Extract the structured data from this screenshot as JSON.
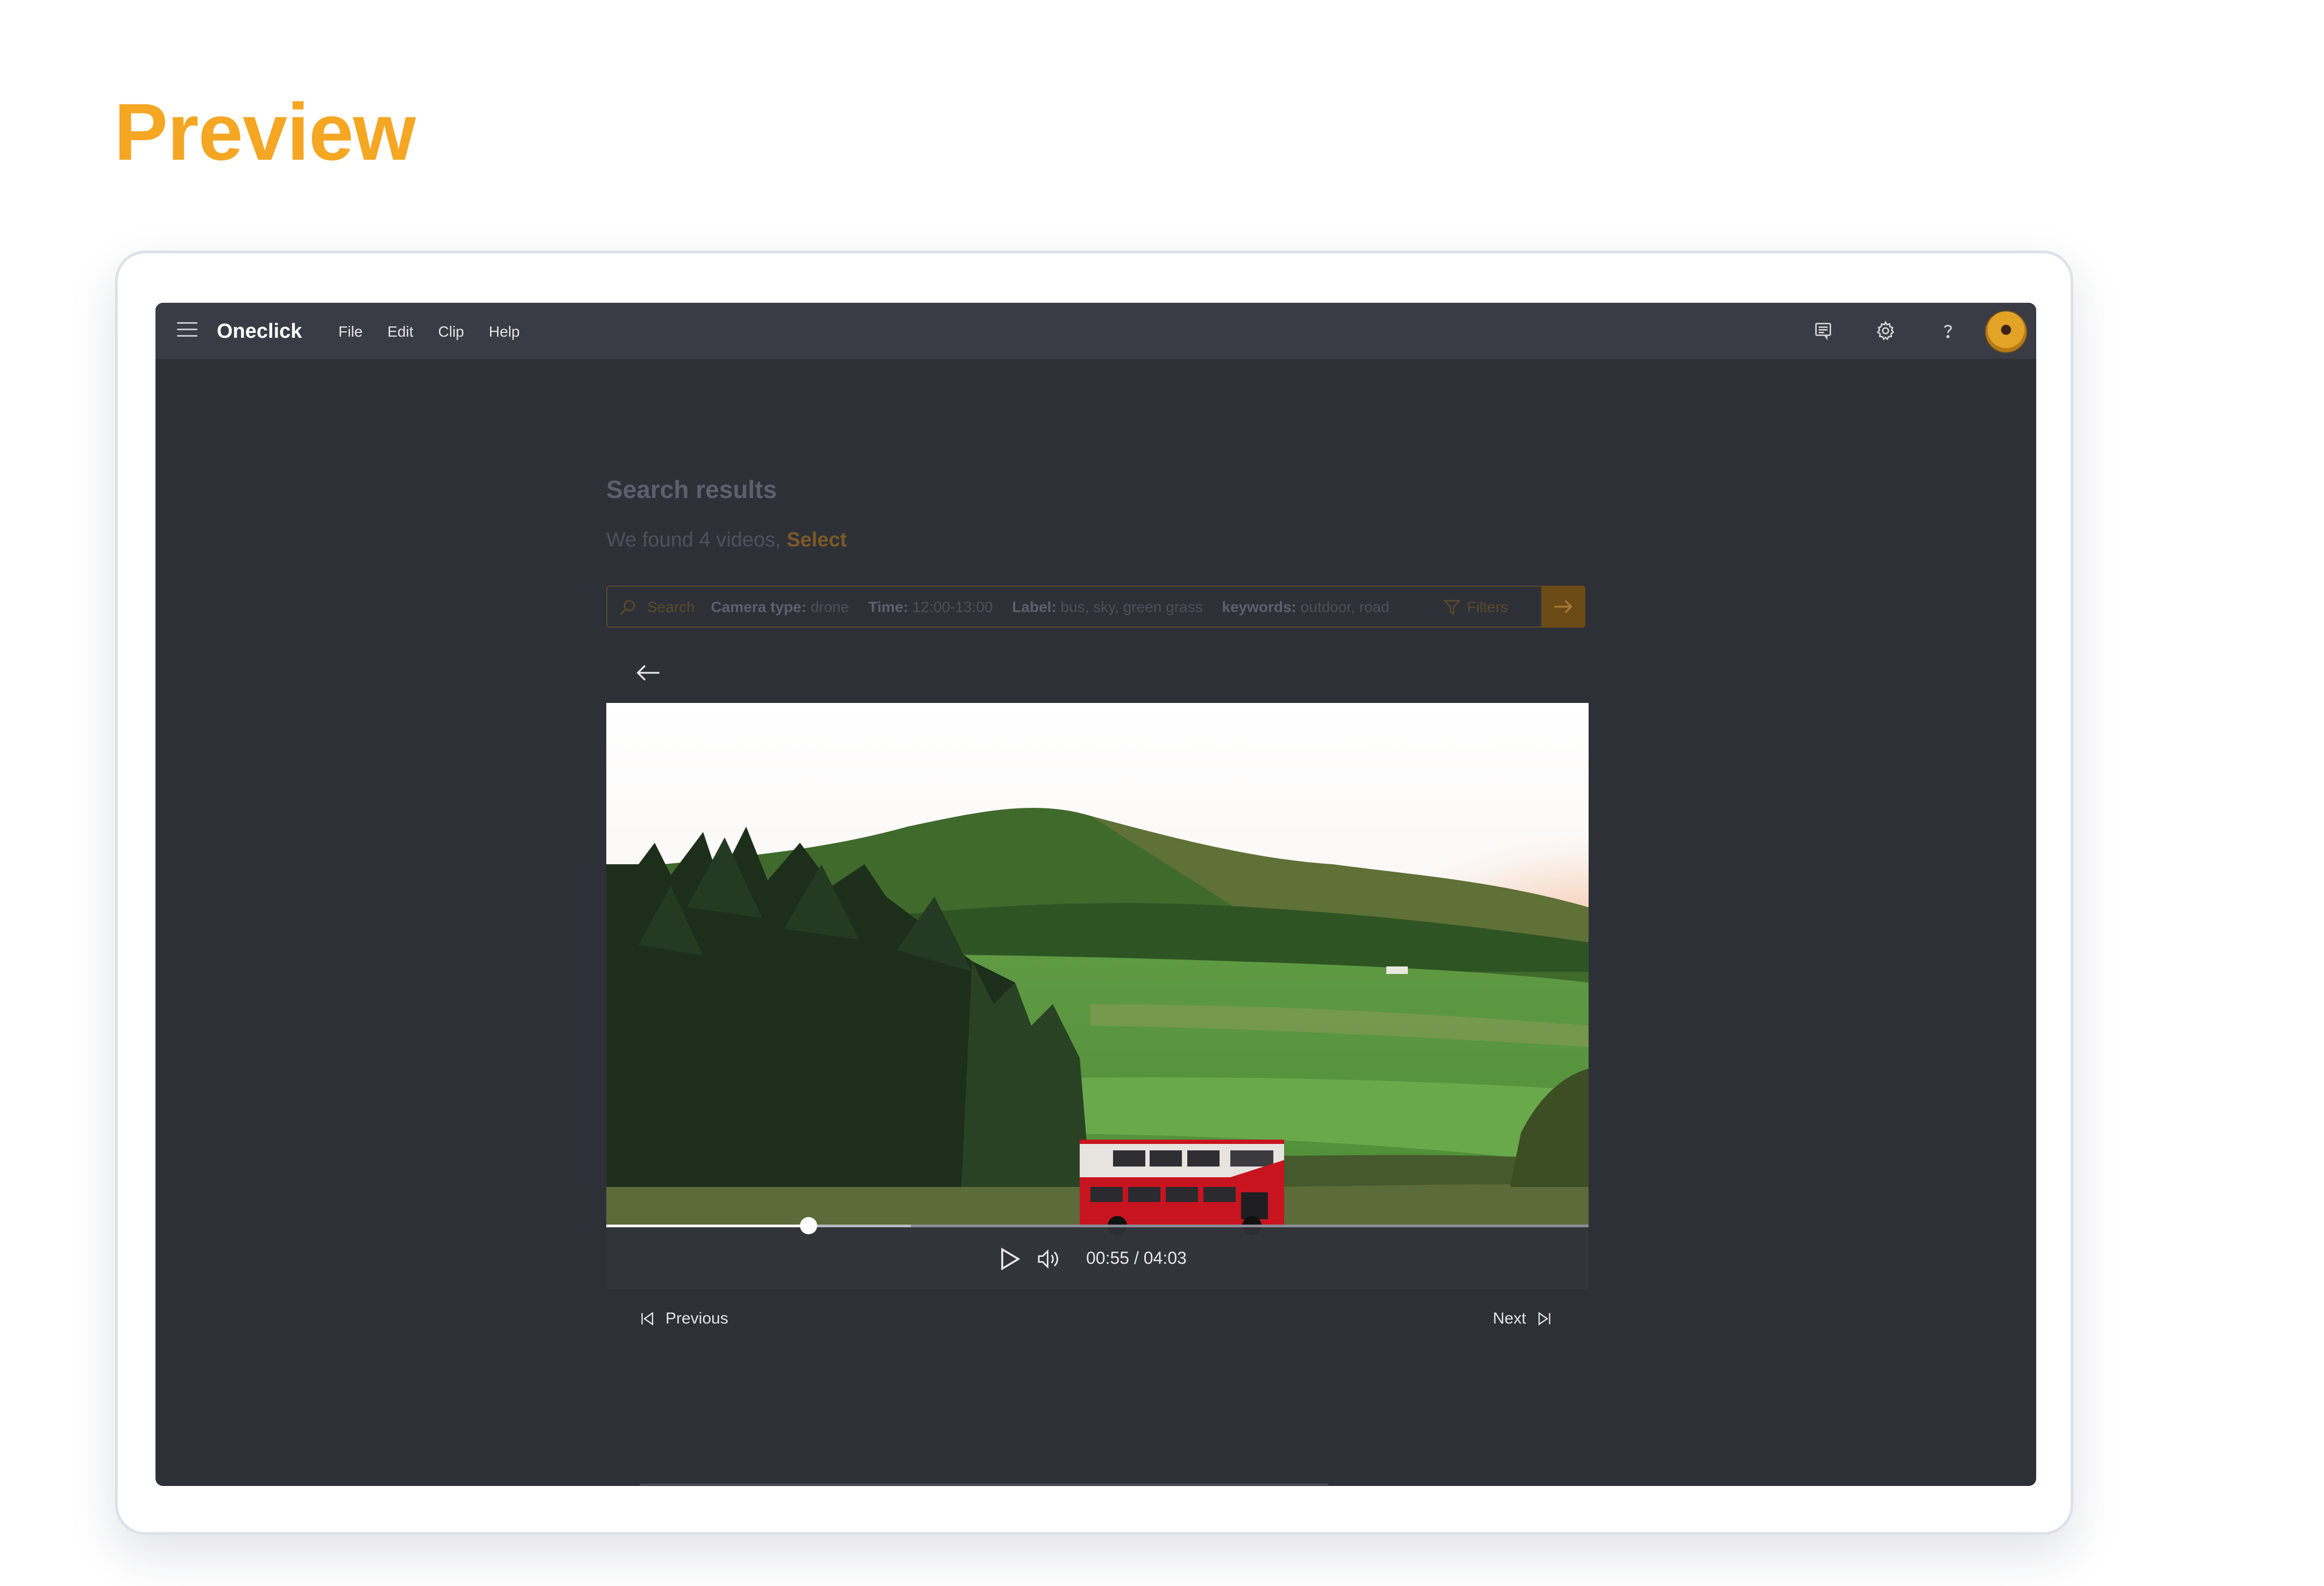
{
  "heading": "Preview",
  "app": {
    "name": "Oneclick",
    "menus": [
      "File",
      "Edit",
      "Clip",
      "Help"
    ],
    "icons": [
      "menu-icon",
      "feedback-icon",
      "gear-icon",
      "help-icon",
      "avatar"
    ]
  },
  "results": {
    "title": "Search results",
    "found_text": "We found 4 videos,",
    "select_label": "Select"
  },
  "search": {
    "placeholder": "Search",
    "tokens": [
      {
        "key": "Camera type:",
        "value": "drone"
      },
      {
        "key": "Time:",
        "value": "12:00-13:00"
      },
      {
        "key": "Label:",
        "value": "bus, sky, green grass"
      },
      {
        "key": "keywords:",
        "value": "outdoor, road"
      }
    ],
    "filters_label": "Filters"
  },
  "player": {
    "current_time": "00:55",
    "duration": "04:03",
    "time_text": "00:55 / 04:03",
    "progress_fraction": 0.206,
    "buffered_fraction": 0.31
  },
  "navigation": {
    "previous_label": "Previous",
    "next_label": "Next"
  },
  "colors": {
    "accent": "#f5a623",
    "accent_dim": "#6b4a16",
    "app_bg": "#2e3038",
    "topbar_bg": "#3a3c45"
  }
}
